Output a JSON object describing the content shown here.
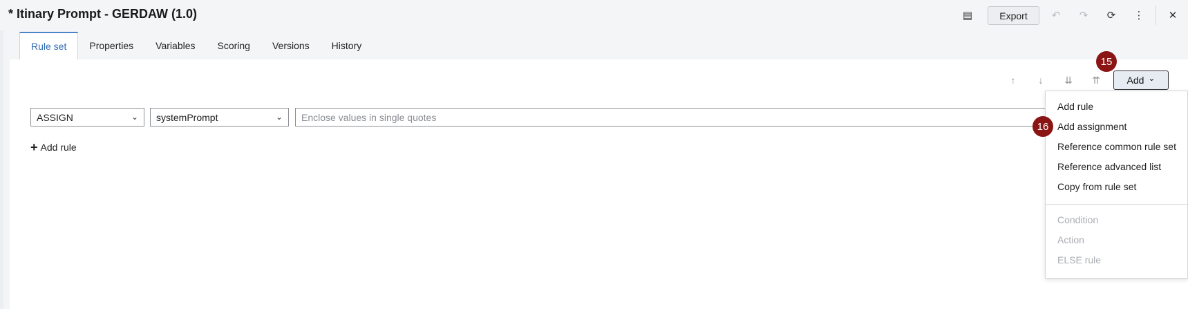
{
  "window": {
    "title": "* Itinary Prompt - GERDAW (1.0)"
  },
  "toolbar": {
    "save_icon": "save-icon",
    "export_label": "Export",
    "undo_icon": "undo-icon",
    "redo_icon": "redo-icon",
    "refresh_icon": "refresh-icon",
    "more_icon": "more-vertical-icon",
    "close_icon": "close-icon",
    "glyphs": {
      "save": "▤",
      "undo": "↶",
      "redo": "↷",
      "refresh": "⟳",
      "more": "⋮",
      "close": "✕"
    }
  },
  "tabs": [
    {
      "label": "Rule set",
      "active": true
    },
    {
      "label": "Properties",
      "active": false
    },
    {
      "label": "Variables",
      "active": false
    },
    {
      "label": "Scoring",
      "active": false
    },
    {
      "label": "Versions",
      "active": false
    },
    {
      "label": "History",
      "active": false
    }
  ],
  "rule_toolbar": {
    "move_up_glyph": "↑",
    "move_down_glyph": "↓",
    "expand_all_glyph": "⇊",
    "collapse_all_glyph": "⇈",
    "add_label": "Add",
    "add_chevron": "⌄"
  },
  "badges": {
    "b15": "15",
    "b16": "16",
    "color": "#8b1515"
  },
  "rule": {
    "type_value": "ASSIGN",
    "variable_value": "systemPrompt",
    "value_placeholder": "Enclose values in single quotes",
    "chevron": "⌄"
  },
  "add_rule_link": {
    "plus": "+",
    "label": "Add rule"
  },
  "add_menu": {
    "items": [
      {
        "label": "Add rule",
        "disabled": false
      },
      {
        "label": "Add assignment",
        "disabled": false
      },
      {
        "label": "Reference common rule set",
        "disabled": false
      },
      {
        "label": "Reference advanced list",
        "disabled": false
      },
      {
        "label": "Copy from rule set",
        "disabled": false
      }
    ],
    "disabled_items": [
      {
        "label": "Condition",
        "disabled": true
      },
      {
        "label": "Action",
        "disabled": true
      },
      {
        "label": "ELSE rule",
        "disabled": true
      }
    ]
  },
  "colors": {
    "accent": "#2e69b0",
    "tab_border": "#4a84c8",
    "badge": "#8b1515"
  }
}
